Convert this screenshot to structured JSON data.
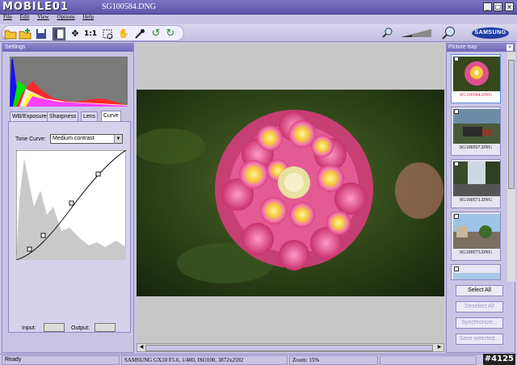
{
  "window": {
    "logo_text": "MOBILE01",
    "title": "SG100584.DNG",
    "controls": [
      "_",
      "□",
      "×"
    ]
  },
  "menu": [
    "File",
    "Edit",
    "View",
    "Options",
    "Help"
  ],
  "toolbar": {
    "brand": "SAMSUNG",
    "fit_label": "1:1"
  },
  "settings": {
    "header": "Settings",
    "tabs": [
      "WB/Exposure",
      "Sharpness",
      "Lens",
      "Curve"
    ],
    "active_tab": "Curve",
    "tone_curve_label": "Tone Curve:",
    "tone_curve_value": "Medium contrast",
    "input_label": "Input:",
    "output_label": "Output:"
  },
  "tray": {
    "header": "Picture tray",
    "items": [
      {
        "caption": "SG100584.DNG",
        "selected": true
      },
      {
        "caption": "SG100567.DNG",
        "selected": false
      },
      {
        "caption": "SG100571.DNG",
        "selected": false
      },
      {
        "caption": "SG100573.DNG",
        "selected": false
      }
    ],
    "buttons": {
      "select_all": "Select All",
      "deselect_all": "Deselect All",
      "synchronize": "Synchronize...",
      "save_selected": "Save selected..."
    }
  },
  "status": {
    "state": "Ready",
    "camera_info": "SAMSUNG GX10   F5.6, 1/400, ISO100, 3872x2592",
    "zoom": "Zoom: 15%",
    "watermark": "#4125"
  },
  "colors": {
    "accent": "#6e66b6",
    "panel": "#c9c4e4",
    "selected_caption": "#dd2233"
  }
}
